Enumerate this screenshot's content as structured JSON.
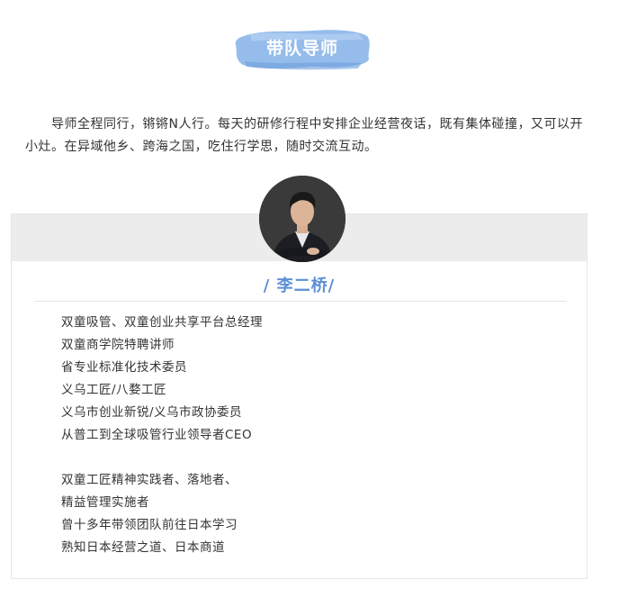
{
  "header": {
    "title": "带队导师"
  },
  "intro": {
    "text": "导师全程同行，锵锵N人行。每天的研修行程中安排企业经营夜话，既有集体碰撞，又可以开小灶。在异域他乡、跨海之国，吃住行学思，随时交流互动。"
  },
  "mentor": {
    "name": "/ 李二桥/",
    "bio_group1": [
      "双童吸管、双童创业共享平台总经理",
      "双童商学院特聘讲师",
      "省专业标准化技术委员",
      "义乌工匠/八婺工匠",
      "义乌市创业新锐/义乌市政协委员",
      "从普工到全球吸管行业领导者CEO"
    ],
    "bio_group2": [
      "双童工匠精神实践者、落地者、",
      "精益管理实施者",
      "曾十多年带领团队前往日本学习",
      "熟知日本经营之道、日本商道"
    ]
  },
  "colors": {
    "accent": "#5b8fd6",
    "title_brush": "#8fb8ea",
    "text": "#333333",
    "band": "#ececec"
  }
}
